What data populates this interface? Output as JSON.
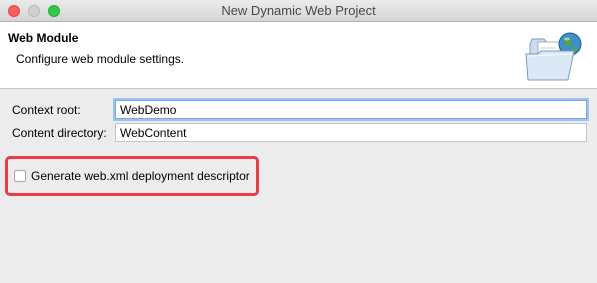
{
  "window": {
    "title": "New Dynamic Web Project"
  },
  "header": {
    "title": "Web Module",
    "description": "Configure web module settings.",
    "icon": "folder-globe-icon"
  },
  "form": {
    "context_root": {
      "label": "Context root:",
      "value": "WebDemo"
    },
    "content_directory": {
      "label": "Content directory:",
      "value": "WebContent"
    },
    "generate_descriptor": {
      "label": "Generate web.xml deployment descriptor",
      "checked": false
    }
  },
  "colors": {
    "highlight": "#ef3b48",
    "focus_ring": "#9cc3f5"
  }
}
